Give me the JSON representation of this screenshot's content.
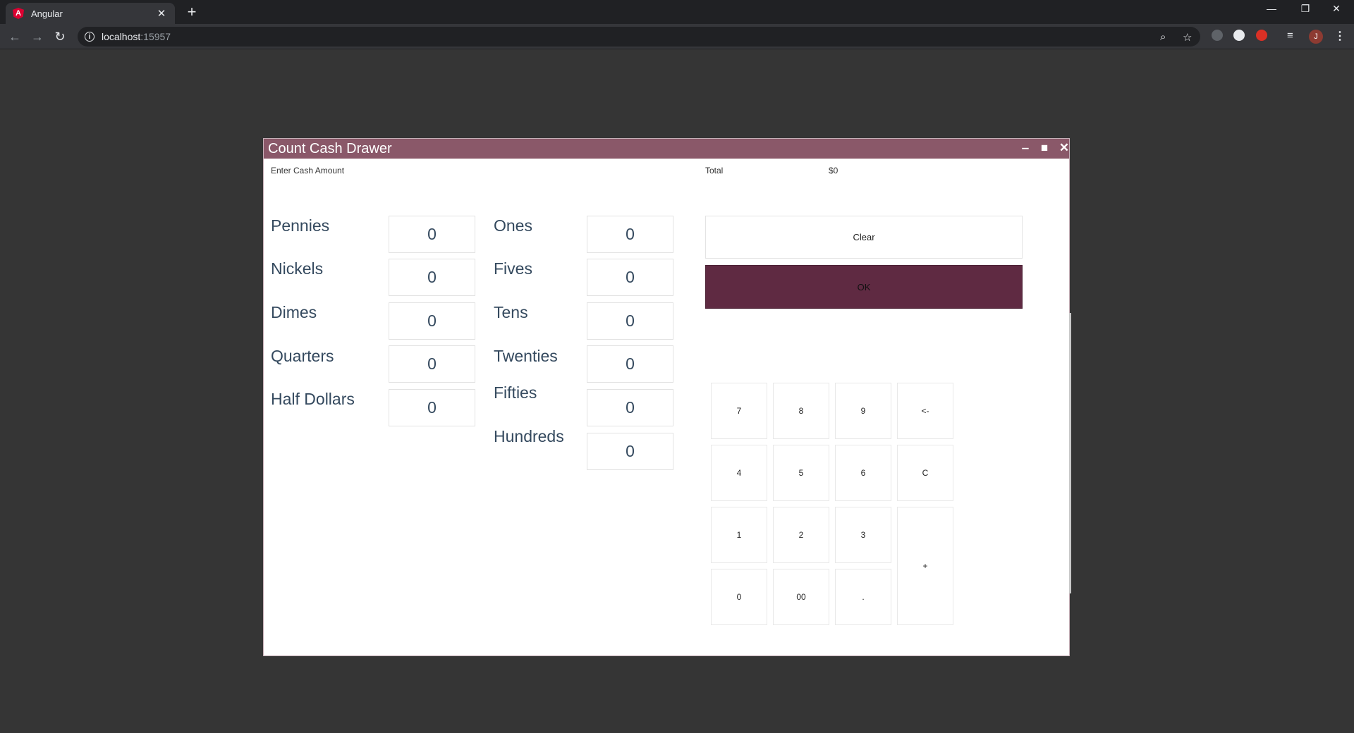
{
  "browser": {
    "tab_title": "Angular",
    "tab_favicon": "A",
    "url_host": "localhost",
    "url_port": ":15957",
    "avatar_initial": "J"
  },
  "dialog": {
    "title": "Count Cash Drawer",
    "enter_label": "Enter Cash Amount",
    "total_label": "Total",
    "total_value": "$0",
    "coins": [
      {
        "label": "Pennies",
        "value": "0"
      },
      {
        "label": "Nickels",
        "value": "0"
      },
      {
        "label": "Dimes",
        "value": "0"
      },
      {
        "label": "Quarters",
        "value": "0"
      },
      {
        "label": "Half Dollars",
        "value": "0"
      }
    ],
    "bills": [
      {
        "label": "Ones",
        "value": "0"
      },
      {
        "label": "Fives",
        "value": "0"
      },
      {
        "label": "Tens",
        "value": "0"
      },
      {
        "label": "Twenties",
        "value": "0"
      },
      {
        "label": "Fifties",
        "value": "0"
      },
      {
        "label": "Hundreds",
        "value": "0"
      }
    ],
    "clear_label": "Clear",
    "ok_label": "OK",
    "keypad": {
      "k7": "7",
      "k8": "8",
      "k9": "9",
      "back": "<-",
      "k4": "4",
      "k5": "5",
      "k6": "6",
      "c": "C",
      "k1": "1",
      "k2": "2",
      "k3": "3",
      "enter": "+",
      "k0": "0",
      "k00": "00",
      "dot": "."
    }
  },
  "colors": {
    "title_bar": "#8a5869",
    "ok_button": "#5f2a42",
    "label_text": "#34495e",
    "background": "#353535"
  }
}
